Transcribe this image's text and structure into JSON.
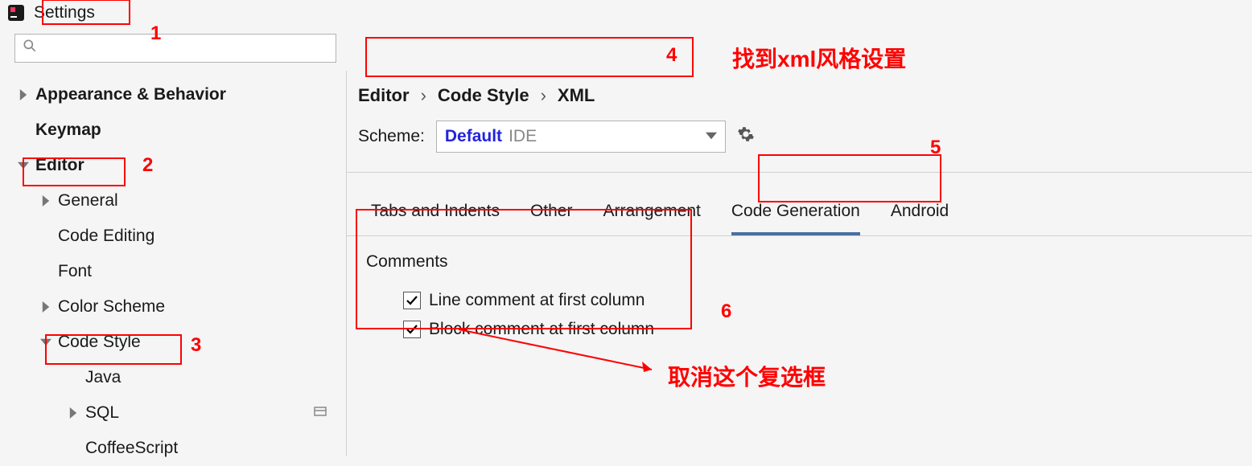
{
  "window": {
    "title": "Settings"
  },
  "search": {
    "placeholder": ""
  },
  "sidebar": {
    "items": [
      {
        "label": "Appearance & Behavior",
        "bold": true,
        "chevron": "right",
        "indent": 0
      },
      {
        "label": "Keymap",
        "bold": true,
        "chevron": "none",
        "indent": 0
      },
      {
        "label": "Editor",
        "bold": true,
        "chevron": "down",
        "indent": 0
      },
      {
        "label": "General",
        "bold": false,
        "chevron": "right",
        "indent": 1
      },
      {
        "label": "Code Editing",
        "bold": false,
        "chevron": "none",
        "indent": 1
      },
      {
        "label": "Font",
        "bold": false,
        "chevron": "none",
        "indent": 1
      },
      {
        "label": "Color Scheme",
        "bold": false,
        "chevron": "right",
        "indent": 1
      },
      {
        "label": "Code Style",
        "bold": false,
        "chevron": "down",
        "indent": 1
      },
      {
        "label": "Java",
        "bold": false,
        "chevron": "none",
        "indent": 2
      },
      {
        "label": "SQL",
        "bold": false,
        "chevron": "right",
        "indent": 2,
        "trailing": true
      },
      {
        "label": "CoffeeScript",
        "bold": false,
        "chevron": "none",
        "indent": 2
      }
    ]
  },
  "breadcrumb": {
    "parts": [
      "Editor",
      "Code Style",
      "XML"
    ]
  },
  "scheme": {
    "label": "Scheme:",
    "selectedPrimary": "Default",
    "selectedSecondary": "IDE"
  },
  "tabs": [
    {
      "label": "Tabs and Indents",
      "active": false
    },
    {
      "label": "Other",
      "active": false
    },
    {
      "label": "Arrangement",
      "active": false
    },
    {
      "label": "Code Generation",
      "active": true
    },
    {
      "label": "Android",
      "active": false
    }
  ],
  "section": {
    "title": "Comments",
    "checks": [
      {
        "label": "Line comment at first column",
        "checked": true
      },
      {
        "label": "Block comment at first column",
        "checked": true
      }
    ]
  },
  "annotations": {
    "n1": "1",
    "n2": "2",
    "n3": "3",
    "n4": "4",
    "n5": "5",
    "n6": "6",
    "t1": "找到xml风格设置",
    "t2": "取消这个复选框"
  }
}
